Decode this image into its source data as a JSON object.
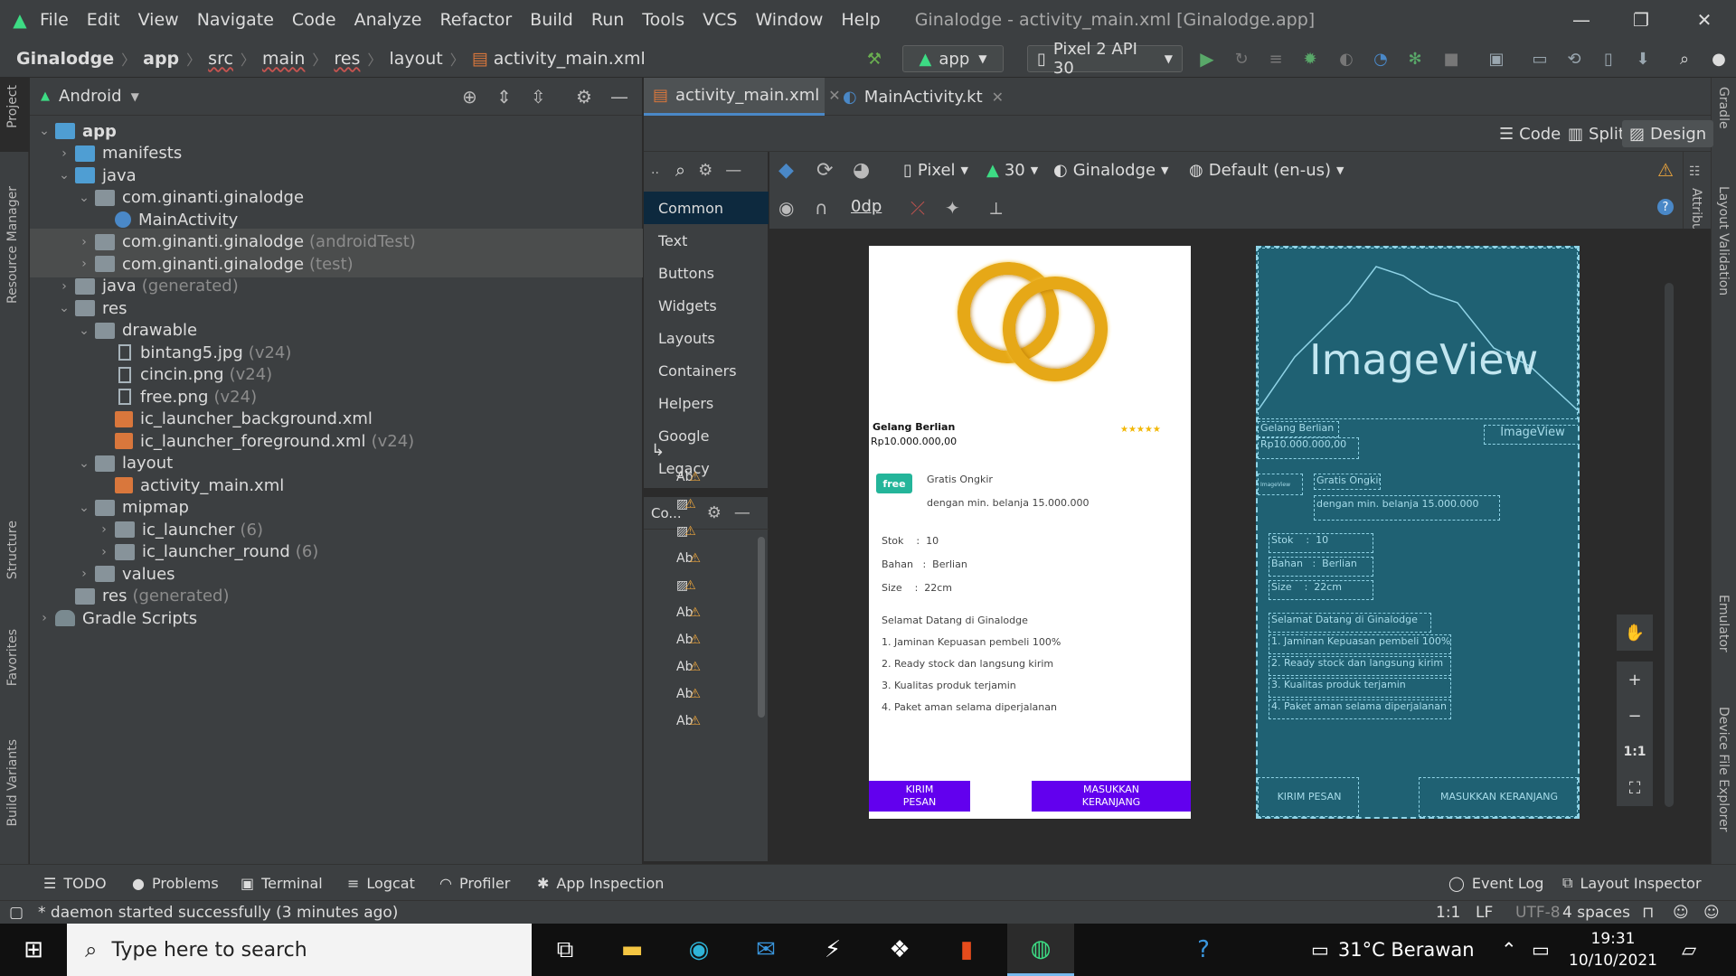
{
  "menubar": {
    "items": [
      "File",
      "Edit",
      "View",
      "Navigate",
      "Code",
      "Analyze",
      "Refactor",
      "Build",
      "Run",
      "Tools",
      "VCS",
      "Window",
      "Help"
    ],
    "window_title": "Ginalodge - activity_main.xml [Ginalodge.app]"
  },
  "navbar": {
    "breadcrumbs": [
      "Ginalodge",
      "app",
      "src",
      "main",
      "res",
      "layout",
      "activity_main.xml"
    ],
    "run_config": "app",
    "device": "Pixel 2 API 30"
  },
  "leftstrip": {
    "tabs": [
      "Project",
      "Resource Manager",
      "Structure",
      "Favorites",
      "Build Variants"
    ]
  },
  "rightstrip": {
    "tabs": [
      "Gradle",
      "Layout Validation",
      "Emulator",
      "Device File Explorer"
    ]
  },
  "project": {
    "view_label": "Android",
    "tree": [
      {
        "label": "app",
        "suffix": "",
        "depth": 0,
        "arrow": "down",
        "icon": "module"
      },
      {
        "label": "manifests",
        "suffix": "",
        "depth": 1,
        "arrow": "right",
        "icon": "folder-blue"
      },
      {
        "label": "java",
        "suffix": "",
        "depth": 1,
        "arrow": "down",
        "icon": "folder-blue"
      },
      {
        "label": "com.ginanti.ginalodge",
        "suffix": "",
        "depth": 2,
        "arrow": "down",
        "icon": "folder"
      },
      {
        "label": "MainActivity",
        "suffix": "",
        "depth": 3,
        "arrow": "",
        "icon": "kotlin"
      },
      {
        "label": "com.ginanti.ginalodge",
        "suffix": "(androidTest)",
        "depth": 2,
        "arrow": "right",
        "icon": "folder",
        "selected": true
      },
      {
        "label": "com.ginanti.ginalodge",
        "suffix": "(test)",
        "depth": 2,
        "arrow": "right",
        "icon": "folder",
        "selected": true
      },
      {
        "label": "java",
        "suffix": "(generated)",
        "depth": 1,
        "arrow": "right",
        "icon": "folder-gen"
      },
      {
        "label": "res",
        "suffix": "",
        "depth": 1,
        "arrow": "down",
        "icon": "folder-res"
      },
      {
        "label": "drawable",
        "suffix": "",
        "depth": 2,
        "arrow": "down",
        "icon": "folder"
      },
      {
        "label": "bintang5.jpg",
        "suffix": "(v24)",
        "depth": 3,
        "arrow": "",
        "icon": "image"
      },
      {
        "label": "cincin.png",
        "suffix": "(v24)",
        "depth": 3,
        "arrow": "",
        "icon": "image"
      },
      {
        "label": "free.png",
        "suffix": "(v24)",
        "depth": 3,
        "arrow": "",
        "icon": "image"
      },
      {
        "label": "ic_launcher_background.xml",
        "suffix": "",
        "depth": 3,
        "arrow": "",
        "icon": "xml"
      },
      {
        "label": "ic_launcher_foreground.xml",
        "suffix": "(v24)",
        "depth": 3,
        "arrow": "",
        "icon": "xml"
      },
      {
        "label": "layout",
        "suffix": "",
        "depth": 2,
        "arrow": "down",
        "icon": "folder"
      },
      {
        "label": "activity_main.xml",
        "suffix": "",
        "depth": 3,
        "arrow": "",
        "icon": "xml"
      },
      {
        "label": "mipmap",
        "suffix": "",
        "depth": 2,
        "arrow": "down",
        "icon": "folder"
      },
      {
        "label": "ic_launcher",
        "suffix": "(6)",
        "depth": 3,
        "arrow": "right",
        "icon": "folder"
      },
      {
        "label": "ic_launcher_round",
        "suffix": "(6)",
        "depth": 3,
        "arrow": "right",
        "icon": "folder"
      },
      {
        "label": "values",
        "suffix": "",
        "depth": 2,
        "arrow": "right",
        "icon": "folder"
      },
      {
        "label": "res",
        "suffix": "(generated)",
        "depth": 1,
        "arrow": "",
        "icon": "folder-res"
      },
      {
        "label": "Gradle Scripts",
        "suffix": "",
        "depth": 0,
        "arrow": "right",
        "icon": "gradle"
      }
    ]
  },
  "editor": {
    "tabs": [
      {
        "label": "activity_main.xml",
        "active": true
      },
      {
        "label": "MainActivity.kt",
        "active": false
      }
    ],
    "modes": [
      "Code",
      "Split",
      "Design"
    ],
    "active_mode": "Design"
  },
  "palette": {
    "categories": [
      "Common",
      "Text",
      "Buttons",
      "Widgets",
      "Layouts",
      "Containers",
      "Helpers",
      "Google",
      "Legacy"
    ],
    "selected": "Common",
    "tree_label": "Co..."
  },
  "designbar": {
    "device": "Pixel",
    "api": "30",
    "theme": "Ginalodge",
    "locale": "Default (en-us)",
    "margin": "0dp",
    "attributes_label": "Attributes"
  },
  "phone": {
    "product_name": "Gelang Berlian",
    "price": "Rp10.000.000,00",
    "stars": "★★★★★",
    "free_label": "free",
    "shipping_title": "Gratis Ongkir",
    "shipping_sub": "dengan min. belanja 15.000.000",
    "stok": "Stok    :  10",
    "bahan": "Bahan   :  Berlian",
    "size": "Size    :  22cm",
    "welcome": "Selamat Datang di Ginalodge",
    "benefits": [
      "1. Jaminan Kepuasan pembeli 100%",
      "2. Ready stock dan langsung kirim",
      "3. Kualitas produk terjamin",
      "4. Paket aman selama diperjalanan"
    ],
    "btn_send": "KIRIM PESAN",
    "btn_cart": "MASUKKAN KERANJANG"
  },
  "blueprint": {
    "imageview_big": "ImageView",
    "imageview_small": "ImageView",
    "imageview_tiny": "ImageView",
    "product_name": "Gelang Berlian",
    "price": "Rp10.000.000,00",
    "shipping_title": "Gratis Ongkir",
    "shipping_sub": "dengan min. belanja 15.000.000",
    "stok": "Stok    :  10",
    "bahan": "Bahan   :  Berlian",
    "size": "Size    :  22cm",
    "welcome": "Selamat Datang di Ginalodge",
    "benefits": [
      "1. Jaminan Kepuasan pembeli 100%",
      "2. Ready stock dan langsung kirim",
      "3. Kualitas produk terjamin",
      "4. Paket aman selama diperjalanan"
    ],
    "btn_send": "KIRIM PESAN",
    "btn_cart": "MASUKKAN KERANJANG"
  },
  "zoom": {
    "fit": "1:1"
  },
  "tooltabs": {
    "left": [
      "TODO",
      "Problems",
      "Terminal",
      "Logcat",
      "Profiler",
      "App Inspection"
    ],
    "right": [
      "Event Log",
      "Layout Inspector"
    ]
  },
  "status": {
    "message": "* daemon started successfully (3 minutes ago)",
    "position": "1:1",
    "line_sep": "LF",
    "encoding": "UTF-8",
    "indent": "4 spaces"
  },
  "taskbar": {
    "search_placeholder": "Type here to search",
    "weather": "31°C  Berawan",
    "time": "19:31",
    "date": "10/10/2021"
  },
  "colors": {
    "accent": "#4a88c7",
    "android_green": "#3ddc84",
    "button_purple": "#6200ee",
    "blueprint": "#1f6173"
  }
}
